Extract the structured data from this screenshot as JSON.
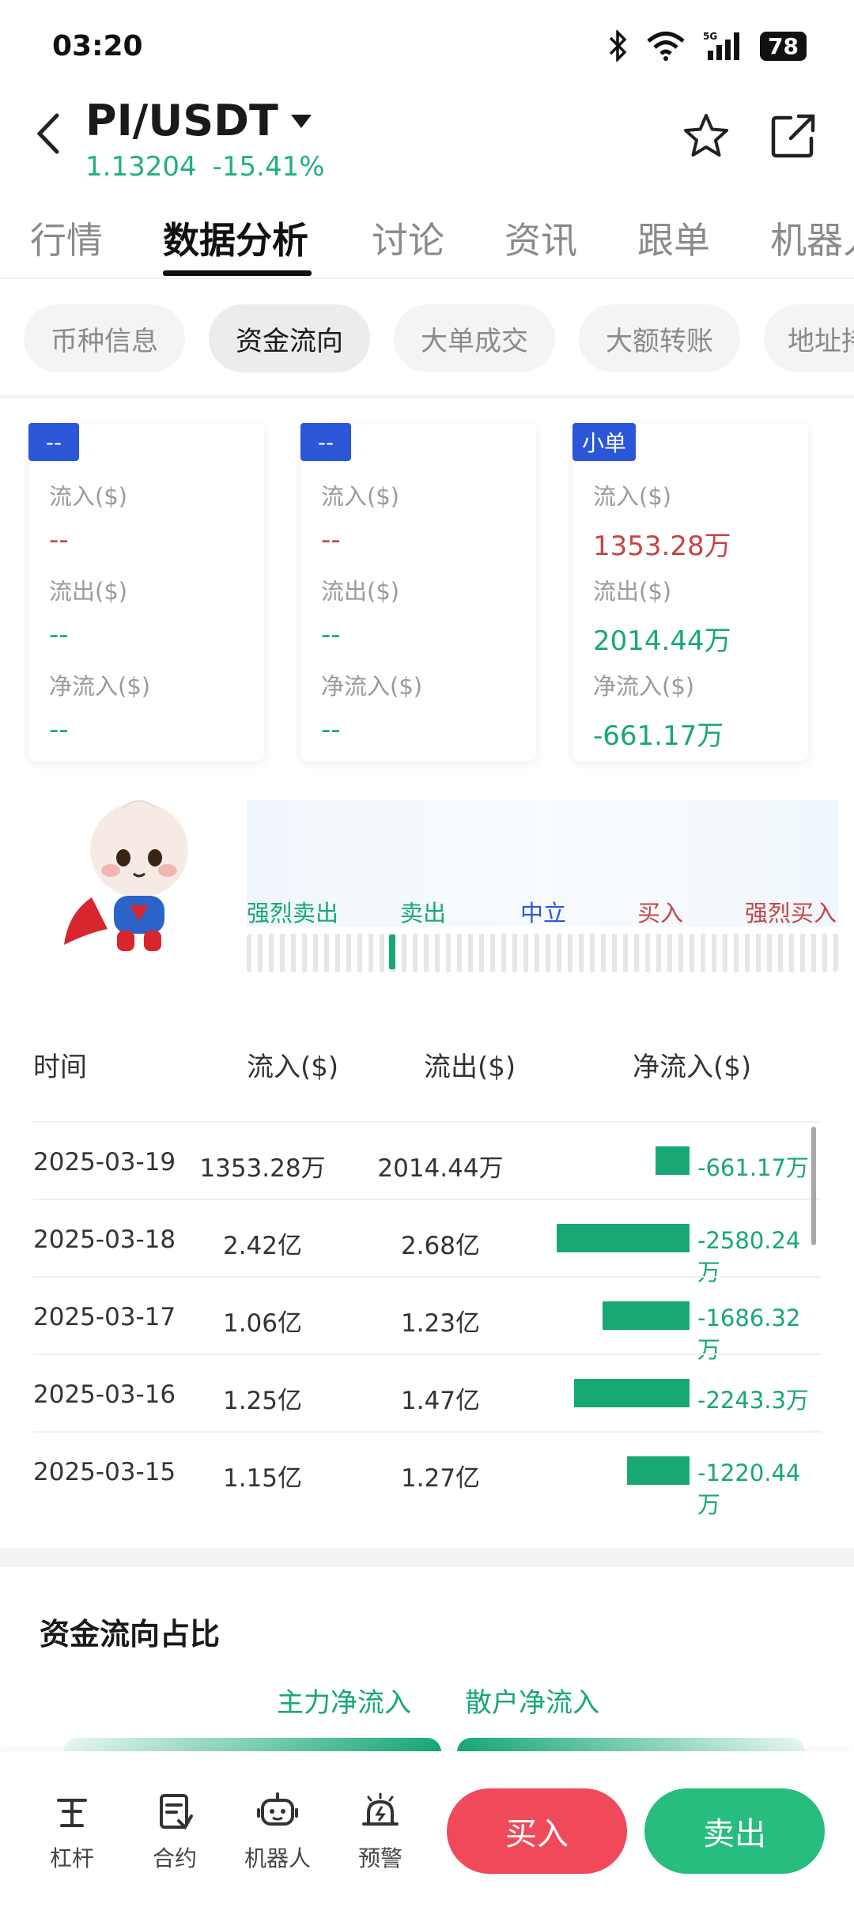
{
  "status": {
    "time": "03:20",
    "battery": "78",
    "network": "5G"
  },
  "header": {
    "pair": "PI/USDT",
    "price": "1.13204",
    "change": "-15.41%"
  },
  "main_tabs": [
    "行情",
    "数据分析",
    "讨论",
    "资讯",
    "跟单",
    "机器人"
  ],
  "sub_tabs": [
    "币种信息",
    "资金流向",
    "大单成交",
    "大额转账",
    "地址持仓"
  ],
  "cards": [
    {
      "badge": "--",
      "inflow_label": "流入($)",
      "inflow": "--",
      "outflow_label": "流出($)",
      "outflow": "--",
      "net_label": "净流入($)",
      "net": "--"
    },
    {
      "badge": "--",
      "inflow_label": "流入($)",
      "inflow": "--",
      "outflow_label": "流出($)",
      "outflow": "--",
      "net_label": "净流入($)",
      "net": "--"
    },
    {
      "badge": "小单",
      "inflow_label": "流入($)",
      "inflow": "1353.28万",
      "outflow_label": "流出($)",
      "outflow": "2014.44万",
      "net_label": "净流入($)",
      "net": "-661.17万"
    }
  ],
  "sentiment": {
    "labels": [
      "强烈卖出",
      "卖出",
      "中立",
      "买入",
      "强烈买入"
    ],
    "level": 0.24
  },
  "table": {
    "headers": [
      "时间",
      "流入($)",
      "流出($)",
      "净流入($)"
    ],
    "rows": [
      {
        "date": "2025-03-19",
        "inflow": "1353.28万",
        "outflow": "2014.44万",
        "net": "-661.17万",
        "net_value": -661.17
      },
      {
        "date": "2025-03-18",
        "inflow": "2.42亿",
        "outflow": "2.68亿",
        "net": "-2580.24万",
        "net_value": -2580.24
      },
      {
        "date": "2025-03-17",
        "inflow": "1.06亿",
        "outflow": "1.23亿",
        "net": "-1686.32万",
        "net_value": -1686.32
      },
      {
        "date": "2025-03-16",
        "inflow": "1.25亿",
        "outflow": "1.47亿",
        "net": "-2243.3万",
        "net_value": -2243.3
      },
      {
        "date": "2025-03-15",
        "inflow": "1.15亿",
        "outflow": "1.27亿",
        "net": "-1220.44万",
        "net_value": -1220.44
      }
    ]
  },
  "ratio_section": {
    "title": "资金流向占比",
    "legend_main": "主力净流入",
    "legend_retail": "散户净流入"
  },
  "bottom_bar": {
    "items": [
      {
        "label": "杠杆",
        "icon": "leverage-icon"
      },
      {
        "label": "合约",
        "icon": "contract-icon"
      },
      {
        "label": "机器人",
        "icon": "robot-icon"
      },
      {
        "label": "预警",
        "icon": "alert-icon"
      }
    ],
    "buy": "买入",
    "sell": "卖出"
  },
  "colors": {
    "up": "#c64545",
    "down": "#17a873",
    "buy": "#f0495a",
    "sell": "#26bd7e",
    "badge": "#2b56d8"
  }
}
